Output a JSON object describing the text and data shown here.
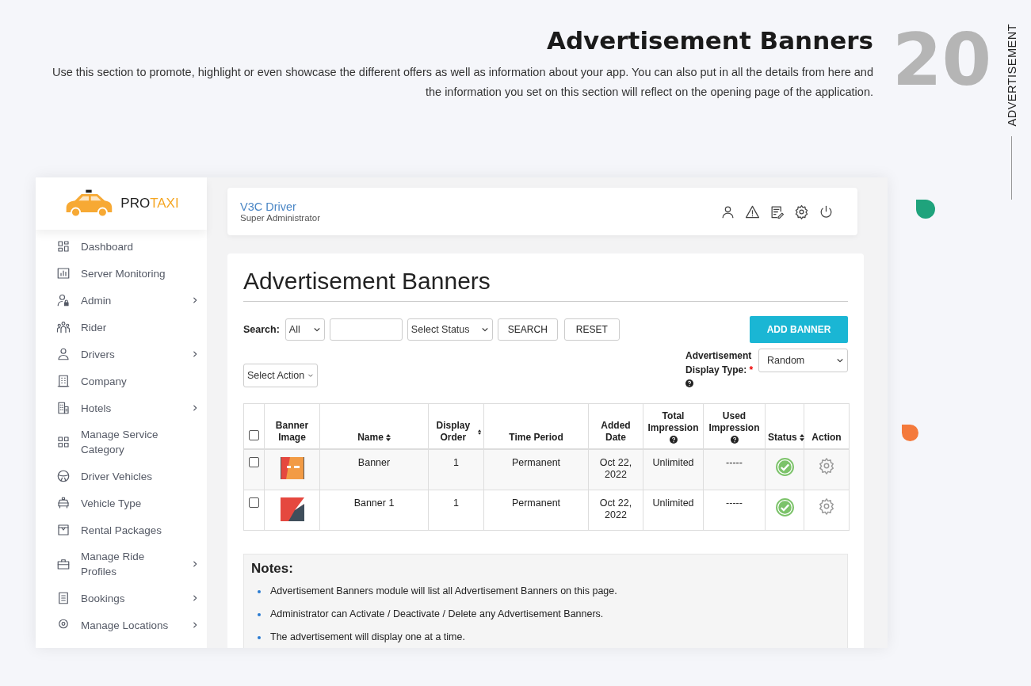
{
  "header": {
    "title": "Advertisement Banners",
    "description": "Use this section to promote, highlight or even showcase the different offers as well as information about your app. You can also put in all the details from here and the information you set on this section will reflect on the opening page of the application.",
    "section_number": "20",
    "section_label": "ADVERTISEMENT"
  },
  "app": {
    "logo": {
      "prefix": "PRO",
      "suffix": "TAXI"
    },
    "sidebar": {
      "items": [
        {
          "label": "Dashboard",
          "has_submenu": false
        },
        {
          "label": "Server Monitoring",
          "has_submenu": false
        },
        {
          "label": "Admin",
          "has_submenu": true
        },
        {
          "label": "Rider",
          "has_submenu": false
        },
        {
          "label": "Drivers",
          "has_submenu": true
        },
        {
          "label": "Company",
          "has_submenu": false
        },
        {
          "label": "Hotels",
          "has_submenu": true
        },
        {
          "label": "Manage Service Category",
          "has_submenu": false
        },
        {
          "label": "Driver Vehicles",
          "has_submenu": false
        },
        {
          "label": "Vehicle Type",
          "has_submenu": false
        },
        {
          "label": "Rental Packages",
          "has_submenu": false
        },
        {
          "label": "Manage Ride Profiles",
          "has_submenu": true
        },
        {
          "label": "Bookings",
          "has_submenu": true
        },
        {
          "label": "Manage Locations",
          "has_submenu": true
        }
      ]
    },
    "topbar": {
      "user_name": "V3C Driver",
      "role": "Super Administrator"
    },
    "page": {
      "title": "Advertisement Banners",
      "search_label": "Search:",
      "search_scope": "All",
      "status_select": "Select Status",
      "search_button": "SEARCH",
      "reset_button": "RESET",
      "add_button": "ADD BANNER",
      "action_select": "Select Action",
      "display_type_label": "Advertisement Display Type:",
      "required_mark": "*",
      "display_type": "Random",
      "table": {
        "select_all": {
          "checked": false
        },
        "columns": [
          {
            "label": "Banner Image",
            "sortable": false,
            "help": false
          },
          {
            "label": "Name",
            "sortable": true,
            "help": false
          },
          {
            "label": "Display Order",
            "sortable": true,
            "help": false
          },
          {
            "label": "Time Period",
            "sortable": false,
            "help": false
          },
          {
            "label": "Added Date",
            "sortable": false,
            "help": false
          },
          {
            "label": "Total Impression",
            "sortable": false,
            "help": true
          },
          {
            "label": "Used Impression",
            "sortable": false,
            "help": true
          },
          {
            "label": "Status",
            "sortable": true,
            "help": false
          },
          {
            "label": "Action",
            "sortable": false,
            "help": false
          }
        ],
        "rows": [
          {
            "checked": false,
            "name": "Banner",
            "display_order": "1",
            "time_period": "Permanent",
            "added_date": "Oct 22, 2022",
            "total_impression": "Unlimited",
            "used_impression": "-----",
            "active": true
          },
          {
            "checked": false,
            "name": "Banner 1",
            "display_order": "1",
            "time_period": "Permanent",
            "added_date": "Oct 22, 2022",
            "total_impression": "Unlimited",
            "used_impression": "-----",
            "active": true
          }
        ]
      },
      "notes": {
        "title": "Notes:",
        "items": [
          "Advertisement Banners module will list all Advertisement Banners on this page.",
          "Administrator can Activate / Deactivate / Delete any Advertisement Banners.",
          "The advertisement will display one at a time."
        ]
      }
    }
  }
}
